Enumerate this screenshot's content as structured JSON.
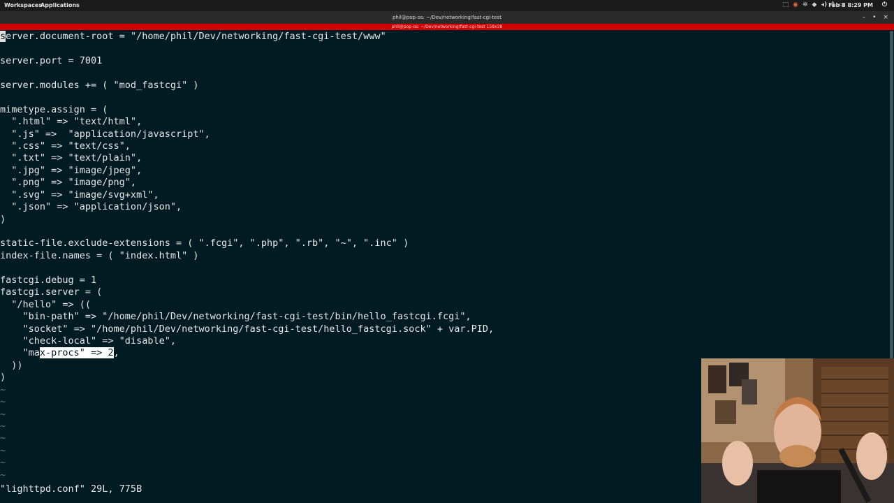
{
  "topbar": {
    "workspaces_label": "Workspaces",
    "applications_label": "Applications",
    "clock": "Feb 8  8:29 PM",
    "tray_icons": [
      "dropbox-icon",
      "record-icon",
      "settings-icon",
      "network-icon",
      "volume-icon",
      "bluetooth-icon",
      "battery-icon"
    ]
  },
  "window": {
    "title": "phil@pop-os: ~/Dev/networking/fast-cgi-test",
    "tab_title": "phil@pop-os: ~/Dev/networking/fast-cgi-test 159x38",
    "controls": [
      "minimize",
      "maximize",
      "close"
    ]
  },
  "editor": {
    "cursor_char": "s",
    "lines": [
      "erver.document-root = \"/home/phil/Dev/networking/fast-cgi-test/www\"",
      "",
      "server.port = 7001",
      "",
      "server.modules += ( \"mod_fastcgi\" )",
      "",
      "mimetype.assign = (",
      "  \".html\" => \"text/html\",",
      "  \".js\" =>  \"application/javascript\",",
      "  \".css\" => \"text/css\",",
      "  \".txt\" => \"text/plain\",",
      "  \".jpg\" => \"image/jpeg\",",
      "  \".png\" => \"image/png\",",
      "  \".svg\" => \"image/svg+xml\",",
      "  \".json\" => \"application/json\",",
      ")",
      "",
      "static-file.exclude-extensions = ( \".fcgi\", \".php\", \".rb\", \"~\", \".inc\" )",
      "index-file.names = ( \"index.html\" )",
      "",
      "fastcgi.debug = 1",
      "fastcgi.server = (",
      "  \"/hello\" => ((",
      "    \"bin-path\" => \"/home/phil/Dev/networking/fast-cgi-test/bin/hello_fastcgi.fcgi\",",
      "    \"socket\" => \"/home/phil/Dev/networking/fast-cgi-test/hello_fastcgi.sock\" + var.PID,",
      "    \"check-local\" => \"disable\","
    ],
    "maxprocs": {
      "pre": "    \"ma",
      "selected": "x-procs\" => 2",
      "post": ","
    },
    "after_lines": [
      "  ))",
      ")"
    ],
    "tilde_lines": [
      "~",
      "~",
      "~",
      "~",
      "~",
      "~",
      "~",
      "~"
    ]
  },
  "status": {
    "message": "\"lighttpd.conf\" 29L, 775B"
  },
  "webcam": {
    "alt": "presenter webcam"
  }
}
